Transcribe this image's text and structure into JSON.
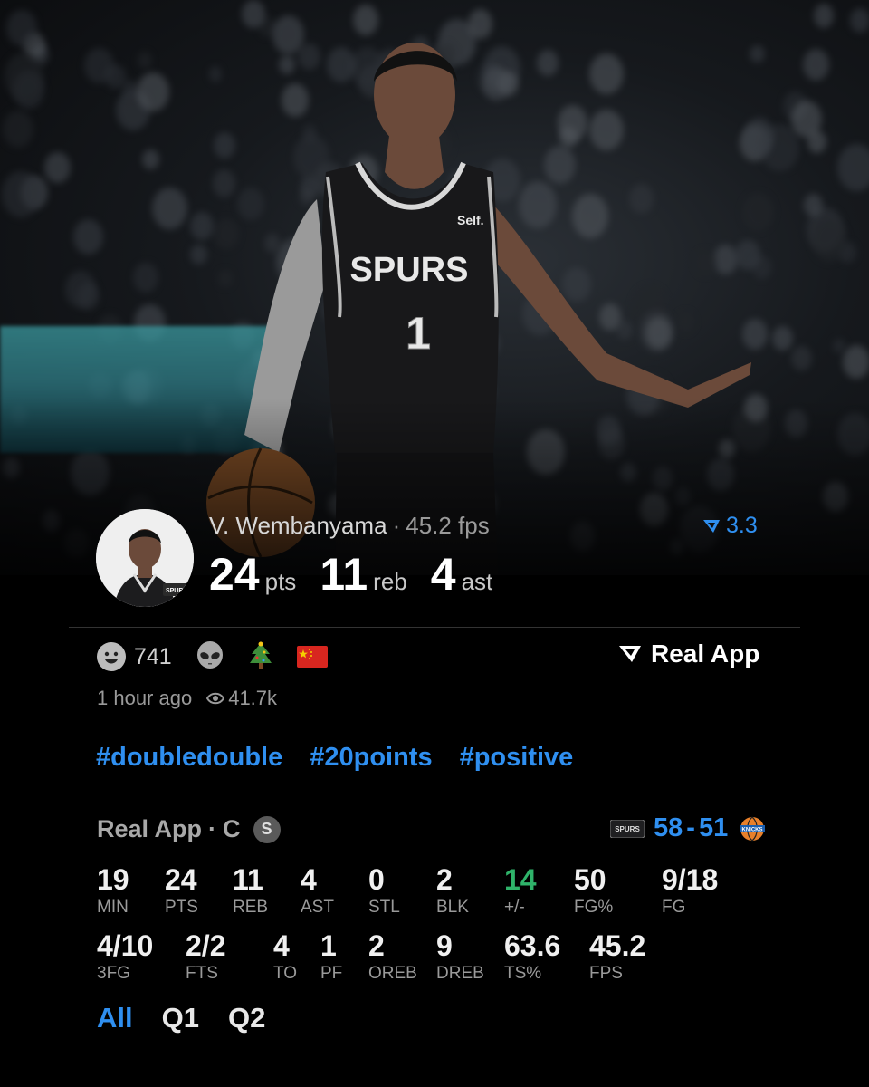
{
  "player": {
    "name": "V. Wembanyama",
    "fps_line": "45.2 fps",
    "rating": "3.3",
    "jersey_team": "SPURS",
    "jersey_number": "1",
    "jersey_sponsor": "Self.",
    "headline_stats": [
      {
        "value": "24",
        "unit": "pts"
      },
      {
        "value": "11",
        "unit": "reb"
      },
      {
        "value": "4",
        "unit": "ast"
      }
    ]
  },
  "reactions": {
    "count": "741",
    "icons": [
      "smile-icon",
      "alien-icon",
      "tree-icon",
      "china-flag-icon"
    ],
    "brand": "Real App"
  },
  "meta": {
    "time_ago": "1 hour ago",
    "views": "41.7k"
  },
  "hashtags": [
    "#doubledouble",
    "#20points",
    "#positive"
  ],
  "box": {
    "source": "Real App",
    "position": "C",
    "badge": "S",
    "score_home": "58",
    "score_away": "51",
    "row1": [
      {
        "value": "19",
        "label": "MIN"
      },
      {
        "value": "24",
        "label": "PTS"
      },
      {
        "value": "11",
        "label": "REB"
      },
      {
        "value": "4",
        "label": "AST"
      },
      {
        "value": "0",
        "label": "STL"
      },
      {
        "value": "2",
        "label": "BLK"
      },
      {
        "value": "14",
        "label": "+/-"
      },
      {
        "value": "50",
        "label": "FG%"
      },
      {
        "value": "9/18",
        "label": "FG"
      }
    ],
    "row2": [
      {
        "value": "4/10",
        "label": "3FG"
      },
      {
        "value": "2/2",
        "label": "FTS"
      },
      {
        "value": "4",
        "label": "TO"
      },
      {
        "value": "1",
        "label": "PF"
      },
      {
        "value": "2",
        "label": "OREB"
      },
      {
        "value": "9",
        "label": "DREB"
      },
      {
        "value": "63.6",
        "label": "TS%"
      },
      {
        "value": "45.2",
        "label": "FPS"
      }
    ]
  },
  "tabs": [
    "All",
    "Q1",
    "Q2"
  ],
  "colors": {
    "accent": "#2f8ff0",
    "positive": "#2fb36a",
    "background": "#000000"
  }
}
